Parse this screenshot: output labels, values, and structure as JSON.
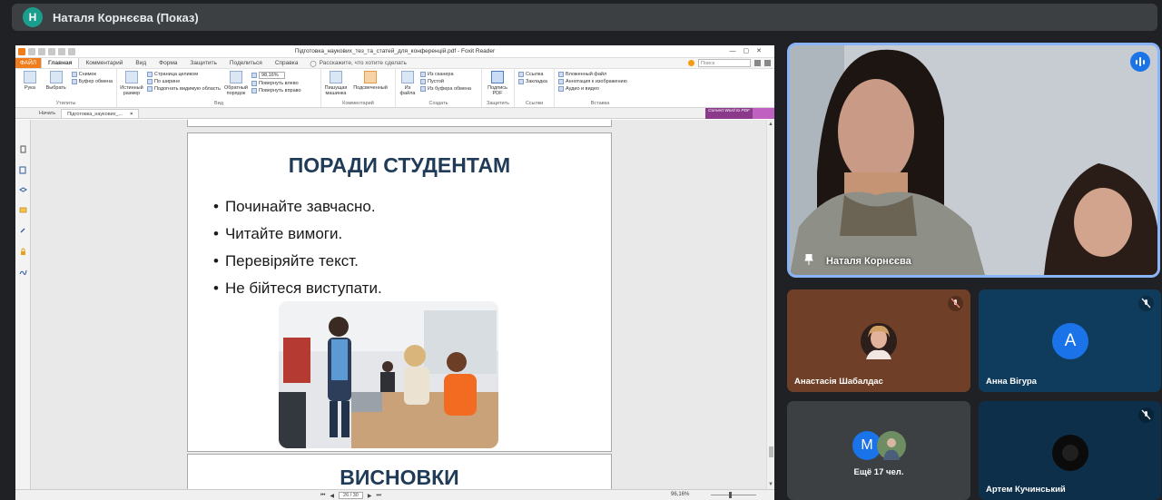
{
  "meeting": {
    "presenter_initial": "Н",
    "presenter_title": "Наталя Корнєєва (Показ)"
  },
  "foxit": {
    "doc_title": "Підготовка_наукових_тез_та_статей_для_конференцій.pdf - Foxit Reader",
    "file_tab": "ФАЙЛ",
    "tabs": [
      "Главная",
      "Комментарий",
      "Вид",
      "Форма",
      "Защитить",
      "Поделиться",
      "Справка"
    ],
    "tell_me": "Расскажите, что хотите сделать",
    "search_placeholder": "Поиск",
    "ribbon": {
      "hand": "Рука",
      "select": "Выбрать",
      "snapshot": "Снимок",
      "clipboard": "Буфер обмена",
      "actual_size": "Истинный размер",
      "fit_page": "Страница целиком",
      "fit_width": "По ширине",
      "fit_visible": "Подогнать видимую область",
      "reflow": "Обратный порядок",
      "zoom_value": "98,16%",
      "rotate_left": "Повернуть влево",
      "rotate_right": "Повернуть вправо",
      "typewriter": "Пишущая машинка",
      "highlight": "Подсвеченный",
      "from_file": "Из файла",
      "from_scanner": "Из сканера",
      "blank": "Пустой",
      "from_clipboard": "Из буфера обмена",
      "sign_pdf": "Подпись PDF",
      "link": "Ссылка",
      "bookmark": "Закладка",
      "file_attachment": "Вложенный файл",
      "image_annotation": "Аннотация к изображению",
      "audio_video": "Аудио и видео",
      "group_tools": "Утилиты",
      "group_view": "Вид",
      "group_comment": "Комментарий",
      "group_create": "Создать",
      "group_protect": "Защитить",
      "group_links": "Ссылки",
      "group_insert": "Вставка"
    },
    "doc_tabs": [
      "Начать",
      "Підготовка_наукових_..."
    ],
    "convert_ad": "Convert Word to PDF",
    "status": {
      "page": "26 / 30",
      "zoom": "96,16%"
    }
  },
  "slide": {
    "title": "ПОРАДИ СТУДЕНТАМ",
    "bullets": [
      "Починайте завчасно.",
      "Читайте вимоги.",
      "Перевіряйте текст.",
      "Не бійтеся виступати."
    ],
    "next_title": "ВИСНОВКИ"
  },
  "participants": {
    "main_name": "Наталя Корнєєва",
    "tile1_name": "Анастасія Шабалдас",
    "tile2_name": "Анна Вігура",
    "tile2_initial": "А",
    "tile3_label": "Ещё 17 чел.",
    "tile3_initial": "М",
    "tile4_name": "Артем Кучинський"
  },
  "colors": {
    "speaking_ring": "#8ab4f8",
    "foxit_orange": "#f07c1c",
    "slide_title": "#1f3b57"
  }
}
